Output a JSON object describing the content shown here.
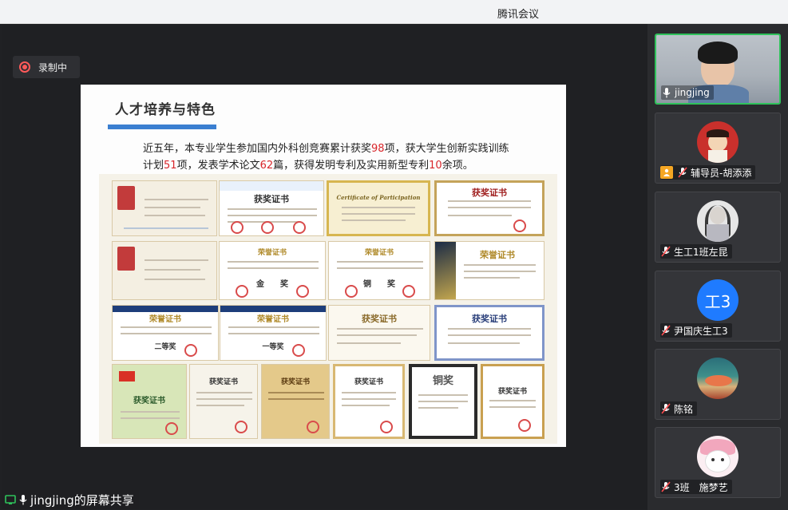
{
  "window": {
    "title": "腾讯会议"
  },
  "recording": {
    "label": "录制中"
  },
  "share": {
    "label": "jingjing的屏幕共享"
  },
  "slide": {
    "title": "人才培养与特色",
    "para": {
      "t1": "近五年，本专业学生参加国内外科创竞赛累计获奖",
      "n1": "98",
      "t2": "项，获大学生创新实践训练计划",
      "n2": "51",
      "t3": "项，发表学术论文",
      "n3": "62",
      "t4": "篇，获得发明专利及实用新型专利",
      "n4": "10",
      "t5": "余项。"
    },
    "certs": {
      "c2": "获奖证书",
      "c3": "Certificate of Participation",
      "c4": "获奖证书",
      "c5": "荣誉证书",
      "c6": "金奖",
      "c7": "铜奖",
      "c8": "荣誉证书",
      "c9": "荣誉证书",
      "c10": "荣誉证书",
      "c11": "获奖证书",
      "c12": "获奖证书",
      "c13": "获奖证书",
      "c14": "获奖证书",
      "c15": "获奖证书",
      "c16": "获奖证书",
      "c17": "铜奖",
      "c18": "获奖证书",
      "p6": "金　　奖",
      "p7": "铜　　奖",
      "p9": "二等奖",
      "p10": "一等奖"
    }
  },
  "participants": [
    {
      "name": "jingjing",
      "muted": false,
      "active": true
    },
    {
      "name": "辅导员-胡添添",
      "muted": true,
      "role": "host"
    },
    {
      "name": "生工1班左昆",
      "muted": true
    },
    {
      "name": "尹国庆生工3",
      "muted": true,
      "avatar_text": "工3"
    },
    {
      "name": "陈铭",
      "muted": true
    },
    {
      "name": "3班　施梦艺",
      "muted": true
    }
  ],
  "colors": {
    "accent_green": "#2fc25b",
    "avatar_blue": "#1f7bff",
    "record_red": "#ff5a5a",
    "slide_bar": "#3b7fd1",
    "highlight_red": "#d9262b"
  }
}
